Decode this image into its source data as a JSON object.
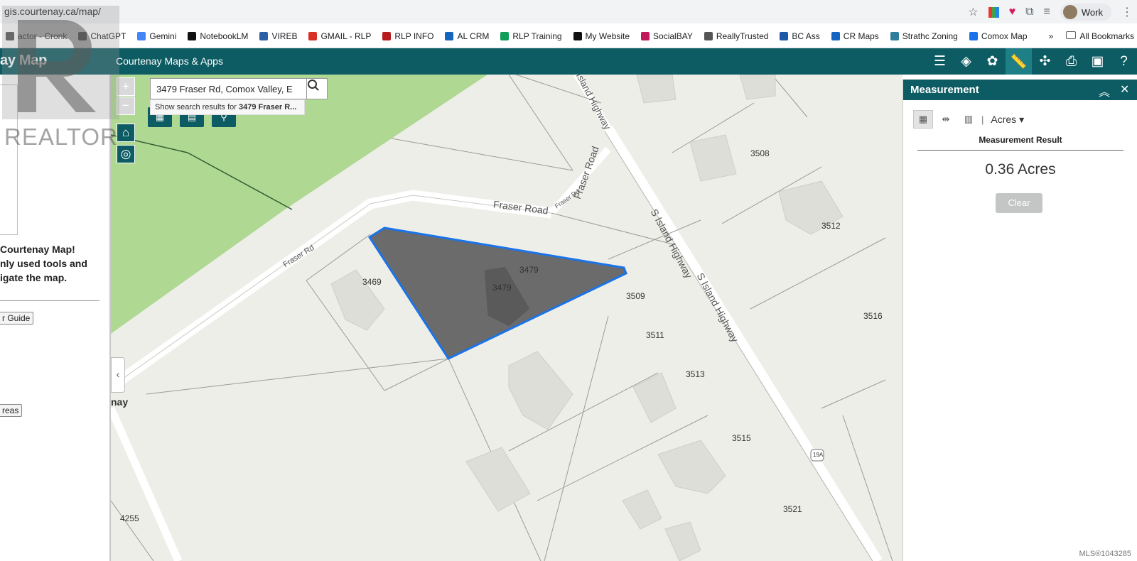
{
  "browser": {
    "url": "gis.courtenay.ca/map/",
    "profile_label": "Work",
    "bookmarks": [
      {
        "label": "actor - Cronk",
        "icon": "realtor-icon",
        "color": "#555555"
      },
      {
        "label": "ChatGPT",
        "icon": "chatgpt-icon",
        "color": "#444444"
      },
      {
        "label": "Gemini",
        "icon": "gemini-icon",
        "color": "#4285f4"
      },
      {
        "label": "NotebookLM",
        "icon": "notebooklm-icon",
        "color": "#111111"
      },
      {
        "label": "VIREB",
        "icon": "vireb-icon",
        "color": "#2b5fa6"
      },
      {
        "label": "GMAIL - RLP",
        "icon": "gmail-icon",
        "color": "#d93025"
      },
      {
        "label": "RLP INFO",
        "icon": "rlp-icon",
        "color": "#b71c1c"
      },
      {
        "label": "AL CRM",
        "icon": "person-icon",
        "color": "#1565c0"
      },
      {
        "label": "RLP Training",
        "icon": "drive-icon",
        "color": "#0f9d58"
      },
      {
        "label": "My Website",
        "icon": "home-icon",
        "color": "#111111"
      },
      {
        "label": "SocialBAY",
        "icon": "socialbay-icon",
        "color": "#c2185b"
      },
      {
        "label": "ReallyTrusted",
        "icon": "reallytrusted-icon",
        "color": "#555555"
      },
      {
        "label": "BC Ass",
        "icon": "bc-icon",
        "color": "#1e5aa8"
      },
      {
        "label": "CR Maps",
        "icon": "crmaps-icon",
        "color": "#1565c0"
      },
      {
        "label": "Strathc Zoning",
        "icon": "zoning-icon",
        "color": "#2e7d9a"
      },
      {
        "label": "Comox Map",
        "icon": "comox-icon",
        "color": "#1a73e8"
      }
    ],
    "more_label": "»",
    "all_bookmarks_label": "All Bookmarks"
  },
  "app": {
    "brand": "ay Map",
    "title": "Courtenay Maps & Apps",
    "toolbar_icons": [
      "layer-list-icon",
      "layers-icon",
      "basemap-icon",
      "measure-icon",
      "share-icon",
      "print-icon",
      "window-icon",
      "help-icon"
    ],
    "active_tool": "measure-icon",
    "header_color": "#0d5c63"
  },
  "left_panel": {
    "welcome_lines": [
      "Courtenay Map!",
      "nly used tools and",
      "igate the map."
    ],
    "guide_button": "r Guide",
    "areas_button": "reas",
    "map_caption": "nay"
  },
  "search": {
    "value": "3479 Fraser Rd, Comox Valley, E",
    "suggestion_prefix": "Show search results for ",
    "suggestion_bold": "3479 Fraser R..."
  },
  "map": {
    "road_labels": {
      "fraser_road": "Fraser Road",
      "fraser_rd": "Fraser Rd",
      "fraser_rd_small": "Fraser Rd",
      "fraser_road_vertical": "Fraser Road",
      "island_highway_top": "Island Highway",
      "s_island_highway": "S Island Highway",
      "s_island_highway_2": "S Island Highway",
      "route_shield": "19A"
    },
    "lot_labels": [
      "3508",
      "3512",
      "3479",
      "3479",
      "3469",
      "3509",
      "3511",
      "3516",
      "3513",
      "3515",
      "3521",
      "4255"
    ],
    "selection_color": "#1a73e8"
  },
  "measurement": {
    "title": "Measurement",
    "unit": "Acres",
    "result_title": "Measurement Result",
    "result_value": "0.36 Acres",
    "clear_label": "Clear"
  },
  "watermark": {
    "realtor_text": "REALTOR",
    "mls_text": "MLS®1043285"
  }
}
